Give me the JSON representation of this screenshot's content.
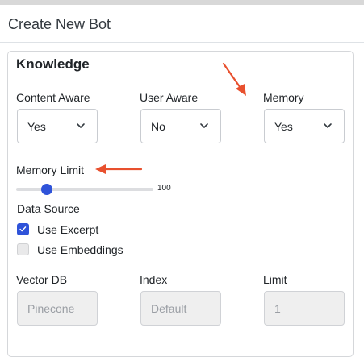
{
  "header": {
    "title": "Create New Bot"
  },
  "knowledge": {
    "section_title": "Knowledge",
    "content_aware": {
      "label": "Content Aware",
      "value": "Yes"
    },
    "user_aware": {
      "label": "User Aware",
      "value": "No"
    },
    "memory": {
      "label": "Memory",
      "value": "Yes"
    },
    "memory_limit": {
      "label": "Memory Limit",
      "value": 100,
      "value_text": "100",
      "max": 1000
    },
    "data_source": {
      "label": "Data Source",
      "options": [
        {
          "label": "Use Excerpt",
          "checked": true
        },
        {
          "label": "Use Embeddings",
          "checked": false
        }
      ]
    },
    "vector_db": {
      "label": "Vector DB",
      "placeholder": "Pinecone"
    },
    "index": {
      "label": "Index",
      "placeholder": "Default"
    },
    "limit": {
      "label": "Limit",
      "placeholder": "1"
    }
  },
  "colors": {
    "accent": "#2f53d9",
    "annotation_arrow": "#e8502e"
  }
}
